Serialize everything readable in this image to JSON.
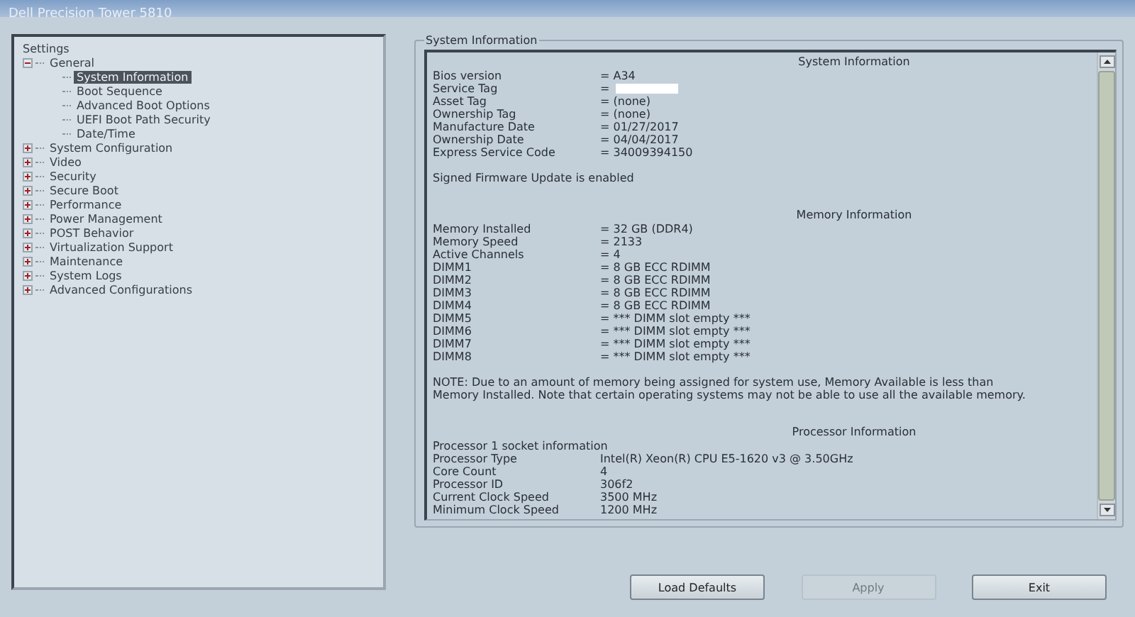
{
  "window": {
    "title": "Dell Precision Tower 5810"
  },
  "tree": {
    "root": "Settings",
    "items": [
      {
        "label": "General",
        "expanded": true,
        "selected": false,
        "children": [
          {
            "label": "System Information",
            "selected": true
          },
          {
            "label": "Boot Sequence",
            "selected": false
          },
          {
            "label": "Advanced Boot Options",
            "selected": false
          },
          {
            "label": "UEFI Boot Path Security",
            "selected": false
          },
          {
            "label": "Date/Time",
            "selected": false
          }
        ]
      },
      {
        "label": "System Configuration",
        "expanded": false,
        "selected": false
      },
      {
        "label": "Video",
        "expanded": false,
        "selected": false
      },
      {
        "label": "Security",
        "expanded": false,
        "selected": false
      },
      {
        "label": "Secure Boot",
        "expanded": false,
        "selected": false
      },
      {
        "label": "Performance",
        "expanded": false,
        "selected": false
      },
      {
        "label": "Power Management",
        "expanded": false,
        "selected": false
      },
      {
        "label": "POST Behavior",
        "expanded": false,
        "selected": false
      },
      {
        "label": "Virtualization Support",
        "expanded": false,
        "selected": false
      },
      {
        "label": "Maintenance",
        "expanded": false,
        "selected": false
      },
      {
        "label": "System Logs",
        "expanded": false,
        "selected": false
      },
      {
        "label": "Advanced Configurations",
        "expanded": false,
        "selected": false
      }
    ]
  },
  "panel": {
    "legend": "System Information",
    "lines": [
      {
        "kind": "heading",
        "text": "System Information"
      },
      {
        "kind": "row",
        "label": "Bios version",
        "value": "= A34"
      },
      {
        "kind": "redacted",
        "label": "Service Tag",
        "value": "="
      },
      {
        "kind": "row",
        "label": "Asset Tag",
        "value": "= (none)"
      },
      {
        "kind": "row",
        "label": "Ownership Tag",
        "value": "= (none)"
      },
      {
        "kind": "row",
        "label": "Manufacture Date",
        "value": "= 01/27/2017"
      },
      {
        "kind": "row",
        "label": "Ownership Date",
        "value": "= 04/04/2017"
      },
      {
        "kind": "row",
        "label": "Express Service Code",
        "value": "= 34009394150"
      },
      {
        "kind": "note",
        "text": "Signed Firmware Update is enabled"
      },
      {
        "kind": "heading",
        "text": "Memory Information"
      },
      {
        "kind": "row",
        "label": "Memory Installed",
        "value": "= 32 GB (DDR4)"
      },
      {
        "kind": "row",
        "label": "Memory Speed",
        "value": "= 2133"
      },
      {
        "kind": "row",
        "label": "Active Channels",
        "value": "= 4"
      },
      {
        "kind": "row",
        "label": "DIMM1",
        "value": "= 8 GB ECC RDIMM"
      },
      {
        "kind": "row",
        "label": "DIMM2",
        "value": "= 8 GB ECC RDIMM"
      },
      {
        "kind": "row",
        "label": "DIMM3",
        "value": "= 8 GB ECC RDIMM"
      },
      {
        "kind": "row",
        "label": "DIMM4",
        "value": "= 8 GB ECC RDIMM"
      },
      {
        "kind": "row",
        "label": "DIMM5",
        "value": "= *** DIMM slot empty ***"
      },
      {
        "kind": "row",
        "label": "DIMM6",
        "value": "= *** DIMM slot empty ***"
      },
      {
        "kind": "row",
        "label": "DIMM7",
        "value": "= *** DIMM slot empty ***"
      },
      {
        "kind": "row",
        "label": "DIMM8",
        "value": "= *** DIMM slot empty ***"
      },
      {
        "kind": "note",
        "text": "NOTE: Due to an amount of memory being assigned for system use, Memory Available is less than Memory Installed. Note that certain operating systems may not be able to use all the available memory."
      },
      {
        "kind": "heading",
        "text": "Processor Information"
      },
      {
        "kind": "text",
        "text": "Processor 1 socket information"
      },
      {
        "kind": "row",
        "label": "Processor Type",
        "value": "Intel(R) Xeon(R) CPU E5-1620 v3 @ 3.50GHz"
      },
      {
        "kind": "row",
        "label": "Core Count",
        "value": "4"
      },
      {
        "kind": "row",
        "label": "Processor ID",
        "value": "306f2"
      },
      {
        "kind": "row",
        "label": "Current Clock Speed",
        "value": "3500 MHz"
      },
      {
        "kind": "row",
        "label": "Minimum Clock Speed",
        "value": "1200 MHz"
      }
    ]
  },
  "buttons": [
    {
      "label": "Load Defaults",
      "disabled": false
    },
    {
      "label": "Apply",
      "disabled": true
    },
    {
      "label": "Exit",
      "disabled": false
    }
  ]
}
